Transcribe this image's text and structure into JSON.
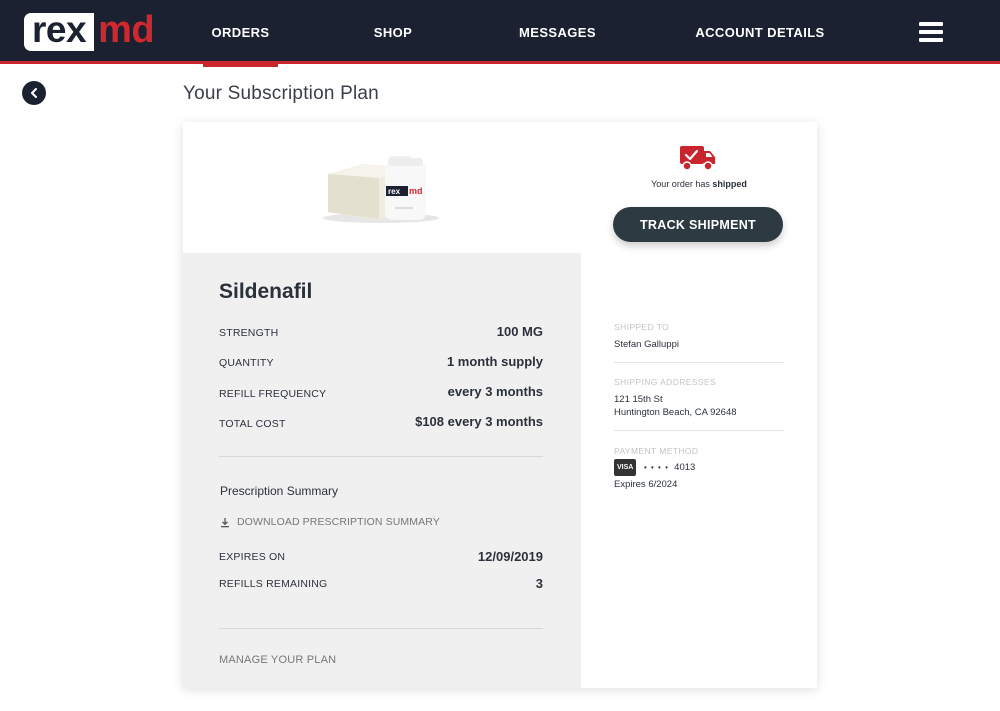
{
  "nav": {
    "logo_rex": "rex",
    "logo_md": "md",
    "items": [
      {
        "label": "ORDERS",
        "active": true
      },
      {
        "label": "SHOP"
      },
      {
        "label": "MESSAGES"
      },
      {
        "label": "ACCOUNT DETAILS"
      }
    ],
    "menu_icon": "hamburger-icon",
    "accent_color": "#c8262c",
    "bg_color": "#1b2130"
  },
  "page": {
    "back_icon": "chevron-left-icon",
    "title": "Your Subscription Plan"
  },
  "product": {
    "image_label_rex": "rex",
    "image_label_md": "md",
    "name": "Sildenafil",
    "details": [
      {
        "label": "STRENGTH",
        "value": "100 MG"
      },
      {
        "label": "QUANTITY",
        "value": "1 month supply"
      },
      {
        "label": "REFILL FREQUENCY",
        "value": "every 3 months"
      },
      {
        "label": "TOTAL COST",
        "value": "$108 every 3 months"
      }
    ]
  },
  "prescription": {
    "section_title": "Prescription Summary",
    "download_label": "DOWNLOAD PRESCRIPTION SUMMARY",
    "rows": [
      {
        "label": "EXPIRES ON",
        "value": "12/09/2019"
      },
      {
        "label": "REFILLS REMAINING",
        "value": "3"
      }
    ],
    "manage_label": "MANAGE YOUR PLAN"
  },
  "shipping": {
    "status_prefix": "Your order has ",
    "status_emphasis": "shipped",
    "track_button": "TRACK SHIPMENT",
    "shipped_to_label": "SHIPPED TO",
    "shipped_to_name": "Stefan Galluppi",
    "address_label": "SHIPPING ADDRESSES",
    "address_line1": "121 15th St",
    "address_line2": "Huntington Beach, CA 92648",
    "payment_label": "PAYMENT METHOD",
    "card_brand": "VISA",
    "card_dots": "• • • •",
    "card_last4": "4013",
    "card_expiry": "Expires 6/2024",
    "truck_color": "#c8262c"
  }
}
